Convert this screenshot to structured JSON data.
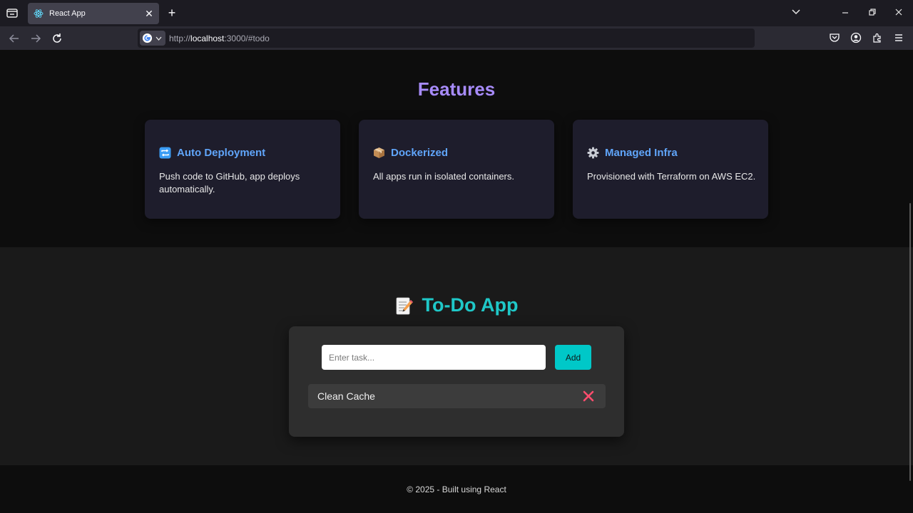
{
  "browser": {
    "tab_title": "React App",
    "url_host": "localhost",
    "url_prefix": "http://",
    "url_suffix": ":3000/#todo"
  },
  "features": {
    "title": "Features",
    "cards": [
      {
        "icon": "repeat-icon",
        "title": "Auto Deployment",
        "description": "Push code to GitHub, app deploys automatically."
      },
      {
        "icon": "package-icon",
        "title": "Dockerized",
        "description": "All apps run in isolated containers."
      },
      {
        "icon": "gear-icon",
        "title": "Managed Infra",
        "description": "Provisioned with Terraform on AWS EC2."
      }
    ]
  },
  "todo": {
    "title": "To-Do App",
    "icon": "memo-icon",
    "input_placeholder": "Enter task...",
    "add_label": "Add",
    "tasks": [
      {
        "text": "Clean Cache"
      }
    ]
  },
  "footer": {
    "text": "© 2025 - Built using React"
  },
  "colors": {
    "features_title": "#a78bfa",
    "card_title": "#60a5fa",
    "todo_title": "#1fc8c8",
    "add_button": "#00c8c8",
    "delete_x": "#ff4d6d"
  }
}
